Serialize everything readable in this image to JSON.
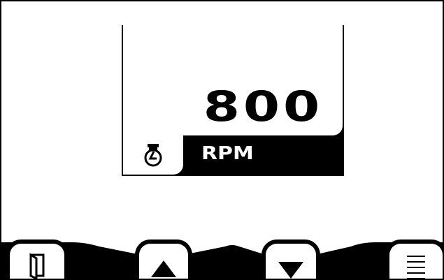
{
  "gauge": {
    "value": "800",
    "unit": "RPM",
    "icon": "engine-speed-icon"
  },
  "softkeys": [
    {
      "name": "exit",
      "icon": "door-exit-icon"
    },
    {
      "name": "up",
      "icon": "arrow-up-icon"
    },
    {
      "name": "down",
      "icon": "arrow-down-icon"
    },
    {
      "name": "menu",
      "icon": "menu-lines-icon"
    }
  ]
}
